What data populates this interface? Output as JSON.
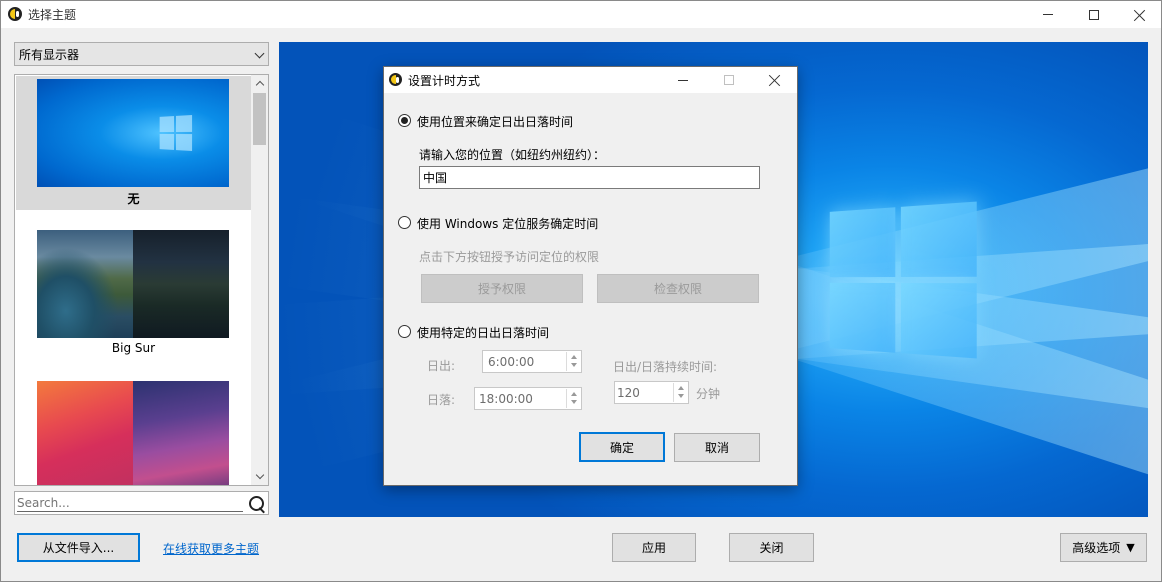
{
  "window": {
    "title": "选择主题"
  },
  "left_panel": {
    "display_select": "所有显示器",
    "themes": [
      {
        "label": "无",
        "selected": true
      },
      {
        "label": "Big Sur",
        "selected": false
      },
      {
        "label": "",
        "selected": false
      }
    ],
    "search_placeholder": "Search..."
  },
  "dialog": {
    "title": "设置计时方式",
    "option_location": "使用位置来确定日出日落时间",
    "location_prompt": "请输入您的位置（如纽约州纽约）：",
    "location_value": "中国",
    "option_windows": "使用 Windows 定位服务确定时间",
    "windows_hint": "点击下方按钮授予访问定位的权限",
    "grant_button": "授予权限",
    "check_button": "检查权限",
    "option_custom": "使用特定的日出日落时间",
    "sunrise_label": "日出:",
    "sunrise_value": "6:00:00",
    "sunset_label": "日落:",
    "sunset_value": "18:00:00",
    "duration_label": "日出/日落持续时间:",
    "duration_value": "120",
    "duration_unit": "分钟",
    "ok_button": "确定",
    "cancel_button": "取消"
  },
  "bottom_bar": {
    "import_button": "从文件导入...",
    "online_link": "在线获取更多主题",
    "apply_button": "应用",
    "close_button": "关闭",
    "advanced_button": "高级选项",
    "advanced_caret": "▼"
  },
  "colors": {
    "accent": "#0078d7",
    "link": "#0066cc",
    "selected_item": "#d9d9d9"
  }
}
